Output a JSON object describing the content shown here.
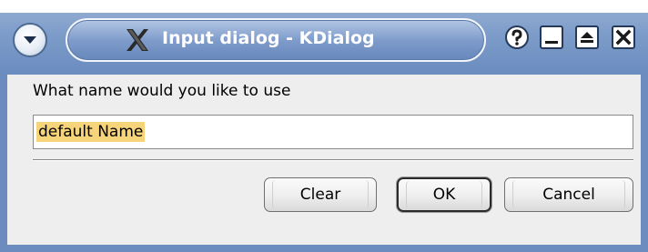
{
  "window": {
    "title": "Input dialog - KDialog"
  },
  "titlebar": {
    "menu_icon": "chevron-down-icon",
    "app_icon": "x-logo-icon",
    "help_icon": "help-icon",
    "minimize_icon": "minimize-icon",
    "maximize_icon": "maximize-icon",
    "close_icon": "close-icon"
  },
  "dialog": {
    "prompt": "What name would you like to use",
    "input": {
      "value": "default Name"
    },
    "buttons": {
      "clear": "Clear",
      "ok": "OK",
      "cancel": "Cancel"
    }
  },
  "colors": {
    "titlebar": "#7d9cc9",
    "frame": "#6c8cbf",
    "selection": "#f6d57a",
    "background": "#eeeeee"
  }
}
